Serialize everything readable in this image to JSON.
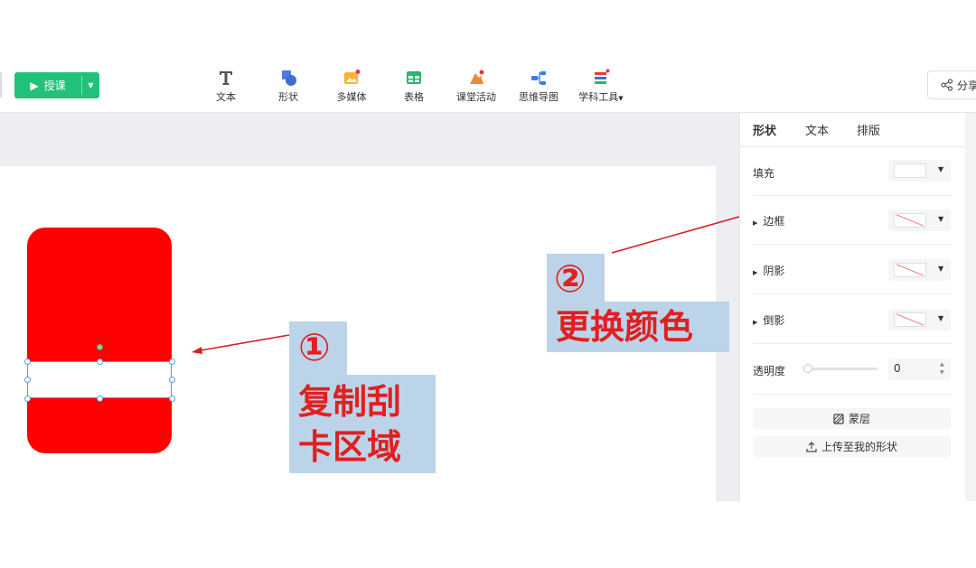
{
  "toolbar": {
    "present_label": "授课",
    "tools": [
      {
        "label": "文本",
        "icon": "text-icon"
      },
      {
        "label": "形状",
        "icon": "shape-icon"
      },
      {
        "label": "多媒体",
        "icon": "multimedia-icon"
      },
      {
        "label": "表格",
        "icon": "table-icon"
      },
      {
        "label": "课堂活动",
        "icon": "classroom-activity-icon"
      },
      {
        "label": "思维导图",
        "icon": "mind-map-icon"
      },
      {
        "label": "学科工具",
        "icon": "subject-tools-icon"
      }
    ],
    "share_label": "分享"
  },
  "colors": {
    "accent_green": "#22c17a",
    "card_red": "#ff0000",
    "callout_bg": "#bcd4ea",
    "callout_text": "#e02020",
    "arrow": "#d42020"
  },
  "annotations": {
    "step1_marker": "①",
    "step1_line1": "复制刮",
    "step1_line2": "卡区域",
    "step2_marker": "②",
    "step2_text": "更换颜色"
  },
  "panel": {
    "tabs": [
      "形状",
      "文本",
      "排版"
    ],
    "fill_label": "填充",
    "border_label": "边框",
    "shadow_label": "阴影",
    "reflection_label": "倒影",
    "opacity_label": "透明度",
    "opacity_value": "0",
    "mask_button": "蒙层",
    "upload_button": "上传至我的形状"
  }
}
